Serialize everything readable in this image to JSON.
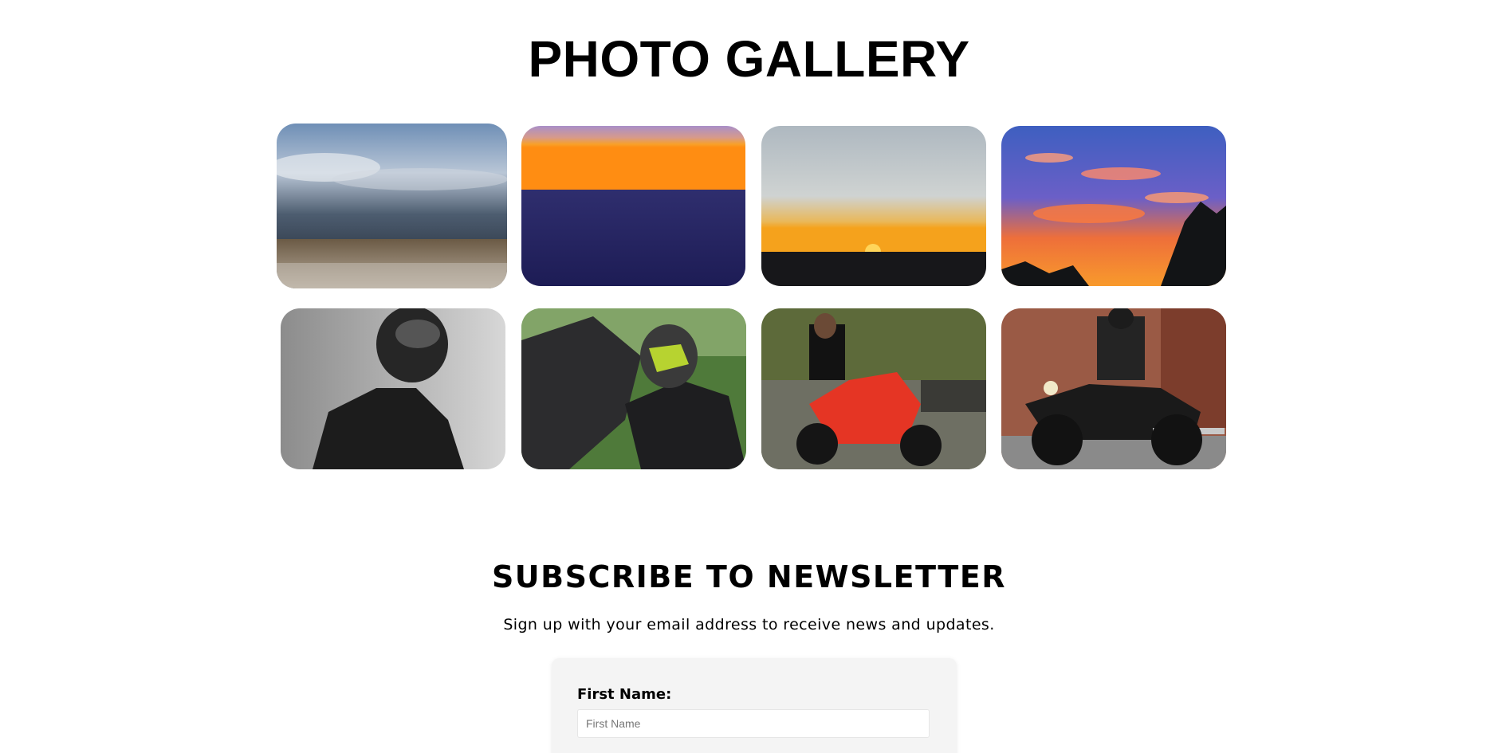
{
  "gallery": {
    "title": "PHOTO GALLERY",
    "photos": [
      {
        "subject": "stormy-sky-prairie"
      },
      {
        "subject": "ocean-sunset"
      },
      {
        "subject": "sunset-over-field"
      },
      {
        "subject": "fiery-cloud-sky"
      },
      {
        "subject": "helmeted-rider-monochrome"
      },
      {
        "subject": "rider-on-sport-bike"
      },
      {
        "subject": "man-on-red-motorcycle"
      },
      {
        "subject": "rider-on-cruiser-motorcycle"
      }
    ]
  },
  "newsletter": {
    "title": "SUBSCRIBE TO NEWSLETTER",
    "subtitle": "Sign up with your email address to receive news and updates.",
    "form": {
      "first_name_label": "First Name:",
      "first_name_placeholder": "First Name",
      "first_name_value": ""
    }
  },
  "colors": {
    "card_background": "#f4f4f4",
    "page_background": "#ffffff",
    "text": "#000000"
  }
}
